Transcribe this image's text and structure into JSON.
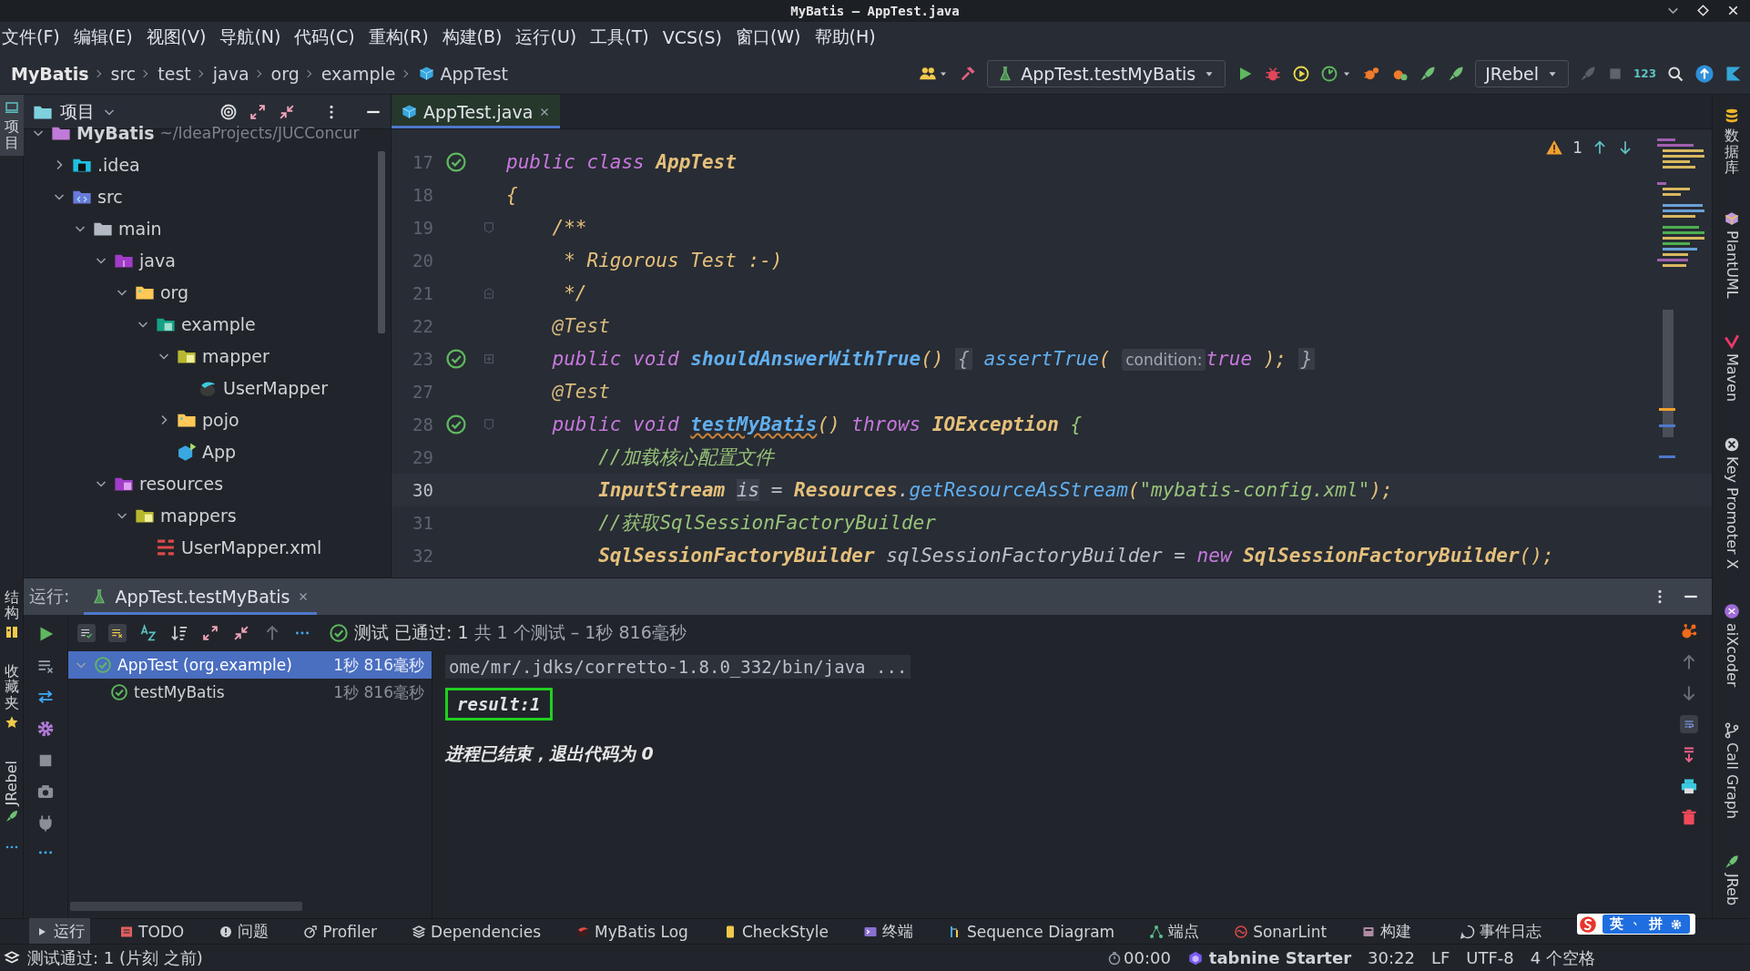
{
  "window": {
    "title": "MyBatis – AppTest.java"
  },
  "menu": [
    "文件(F)",
    "编辑(E)",
    "视图(V)",
    "导航(N)",
    "代码(C)",
    "重构(R)",
    "构建(B)",
    "运行(U)",
    "工具(T)",
    "VCS(S)",
    "窗口(W)",
    "帮助(H)"
  ],
  "breadcrumb": [
    {
      "label": "MyBatis",
      "kind": "project"
    },
    {
      "label": "src",
      "kind": "dir"
    },
    {
      "label": "test",
      "kind": "dir"
    },
    {
      "label": "java",
      "kind": "dir"
    },
    {
      "label": "org",
      "kind": "dir"
    },
    {
      "label": "example",
      "kind": "dir"
    },
    {
      "label": "AppTest",
      "kind": "class"
    }
  ],
  "toolbar": {
    "run_config": "AppTest.testMyBatis",
    "jrebel": "JRebel",
    "counter": "123"
  },
  "left_stripe": [
    {
      "label": "项目",
      "kind": "project",
      "selected": true
    },
    {
      "label": "结构",
      "kind": "structure",
      "selected": false
    },
    {
      "label": "收藏夹",
      "kind": "favorites",
      "selected": false
    },
    {
      "label": "JRebel",
      "kind": "jrebel",
      "selected": false
    }
  ],
  "project": {
    "title": "项目",
    "tree": [
      {
        "label": "MyBatis",
        "path": "~/IdeaProjects/JUCConcur",
        "kind": "module",
        "expanded": true,
        "children": [
          {
            "label": ".idea",
            "kind": "idea",
            "expanded": false
          },
          {
            "label": "src",
            "kind": "source",
            "expanded": true,
            "children": [
              {
                "label": "main",
                "kind": "folder",
                "expanded": true,
                "children": [
                  {
                    "label": "java",
                    "kind": "java-root",
                    "expanded": true,
                    "children": [
                      {
                        "label": "org",
                        "kind": "package",
                        "expanded": true,
                        "children": [
                          {
                            "label": "example",
                            "kind": "test-package",
                            "expanded": true,
                            "children": [
                              {
                                "label": "mapper",
                                "kind": "mapper-package",
                                "expanded": true,
                                "children": [
                                  {
                                    "label": "UserMapper",
                                    "kind": "mapper"
                                  }
                                ]
                              },
                              {
                                "label": "pojo",
                                "kind": "package",
                                "expanded": false
                              },
                              {
                                "label": "App",
                                "kind": "class"
                              }
                            ]
                          }
                        ]
                      }
                    ]
                  },
                  {
                    "label": "resources",
                    "kind": "resources",
                    "expanded": true,
                    "children": [
                      {
                        "label": "mappers",
                        "kind": "mapper-package",
                        "expanded": true,
                        "children": [
                          {
                            "label": "UserMapper.xml",
                            "kind": "xml"
                          }
                        ]
                      }
                    ]
                  }
                ]
              }
            ]
          }
        ]
      }
    ]
  },
  "editor": {
    "tabs": [
      {
        "label": "AppTest.java",
        "selected": true
      }
    ],
    "warnings": "1",
    "lines": [
      {
        "number": "17",
        "marker": {
          "kind": "passed"
        },
        "current": false,
        "tokens": [
          {
            "text": "public class ",
            "kind": "kw"
          },
          {
            "text": "AppTest",
            "kind": "cls"
          }
        ]
      },
      {
        "number": "18",
        "current": false,
        "tokens": [
          {
            "text": "{",
            "kind": "paren"
          }
        ]
      },
      {
        "number": "19",
        "fold": {
          "kind": "start"
        },
        "current": false,
        "tokens": [
          {
            "text": "    /**",
            "kind": "doc"
          }
        ]
      },
      {
        "number": "20",
        "current": false,
        "tokens": [
          {
            "text": "     * Rigorous Test :-)",
            "kind": "doc"
          }
        ]
      },
      {
        "number": "21",
        "fold": {
          "kind": "end"
        },
        "current": false,
        "tokens": [
          {
            "text": "     */",
            "kind": "doc"
          }
        ]
      },
      {
        "number": "22",
        "current": false,
        "tokens": [
          {
            "text": "    @Test",
            "kind": "ann"
          }
        ]
      },
      {
        "number": "23",
        "marker": {
          "kind": "passed"
        },
        "fold": {
          "kind": "collapsed"
        },
        "current": false,
        "tokens": [
          {
            "text": "    public void ",
            "kind": "kw"
          },
          {
            "text": "shouldAnswerWithTrue",
            "kind": "method"
          },
          {
            "text": "() ",
            "kind": "paren"
          },
          {
            "text": "{",
            "kind": "folded"
          },
          {
            "text": " assertTrue",
            "kind": "call"
          },
          {
            "text": "( ",
            "kind": "paren"
          },
          {
            "text": "condition:",
            "kind": "hint"
          },
          {
            "text": "true",
            "kind": "kw"
          },
          {
            "text": " ); ",
            "kind": "paren"
          },
          {
            "text": "}",
            "kind": "folded"
          }
        ]
      },
      {
        "number": "27",
        "current": false,
        "tokens": [
          {
            "text": "    @Test",
            "kind": "ann"
          }
        ]
      },
      {
        "number": "28",
        "marker": {
          "kind": "passed"
        },
        "fold": {
          "kind": "start"
        },
        "current": false,
        "tokens": [
          {
            "text": "    public void ",
            "kind": "kw"
          },
          {
            "text": "testMyBatis",
            "kind": "method-warn"
          },
          {
            "text": "()",
            "kind": "paren"
          },
          {
            "text": " throws ",
            "kind": "kw"
          },
          {
            "text": "IOException ",
            "kind": "cls"
          },
          {
            "text": "{",
            "kind": "brace"
          }
        ]
      },
      {
        "number": "29",
        "current": false,
        "tokens": [
          {
            "text": "        //加载核心配置文件",
            "kind": "comment"
          }
        ]
      },
      {
        "number": "30",
        "current": true,
        "tokens": [
          {
            "text": "        InputStream ",
            "kind": "cls"
          },
          {
            "text": "is",
            "kind": "var"
          },
          {
            "text": " = ",
            "kind": "plain"
          },
          {
            "text": "Resources",
            "kind": "cls"
          },
          {
            "text": ".",
            "kind": "plain"
          },
          {
            "text": "getResourceAsStream",
            "kind": "call"
          },
          {
            "text": "(",
            "kind": "paren"
          },
          {
            "text": "\"mybatis-config.xml\"",
            "kind": "string"
          },
          {
            "text": ");",
            "kind": "paren"
          }
        ]
      },
      {
        "number": "31",
        "current": false,
        "tokens": [
          {
            "text": "        //获取SqlSessionFactoryBuilder",
            "kind": "comment"
          }
        ]
      },
      {
        "number": "32",
        "current": false,
        "tokens": [
          {
            "text": "        SqlSessionFactoryBuilder",
            "kind": "cls"
          },
          {
            "text": " sqlSessionFactoryBuilder = ",
            "kind": "plain"
          },
          {
            "text": "new ",
            "kind": "kw"
          },
          {
            "text": "SqlSessionFactoryBuilder",
            "kind": "cls"
          },
          {
            "text": "();",
            "kind": "paren"
          }
        ]
      }
    ]
  },
  "right_stripe": [
    {
      "label": "数据库",
      "kind": "database"
    },
    {
      "label": "PlantUML",
      "kind": "plantuml"
    },
    {
      "label": "Maven",
      "kind": "maven"
    },
    {
      "label": "Key Promoter X",
      "kind": "keypromoter"
    },
    {
      "label": "aiXcoder",
      "kind": "aixcoder"
    },
    {
      "label": "Call Graph",
      "kind": "callgraph"
    },
    {
      "label": "JReb",
      "kind": "jrebel"
    }
  ],
  "run_panel": {
    "label": "运行:",
    "tabs": [
      {
        "label": "AppTest.testMyBatis",
        "selected": true
      }
    ],
    "summary": {
      "status": "测试 已通过: 1",
      "detail": "共 1 个测试 – 1秒 816毫秒"
    },
    "tests": [
      {
        "label": "AppTest (org.example)",
        "time": "1秒 816毫秒",
        "passed": true,
        "selected": true,
        "expanded": true,
        "children": [
          {
            "label": "testMyBatis",
            "time": "1秒 816毫秒",
            "passed": true,
            "selected": false
          }
        ]
      }
    ],
    "console": [
      {
        "text": "ome/mr/.jdks/corretto-1.8.0_332/bin/java ...",
        "kind": "command",
        "highlighted": false
      },
      {
        "text": "result:1",
        "kind": "output",
        "highlighted": true
      },
      {
        "text": "进程已结束，退出代码为 0",
        "kind": "exit",
        "highlighted": false
      }
    ]
  },
  "tool_tabs": [
    {
      "label": "运行",
      "kind": "run",
      "selected": true
    },
    {
      "label": "TODO",
      "kind": "todo",
      "selected": false
    },
    {
      "label": "问题",
      "kind": "problems",
      "selected": false
    },
    {
      "label": "Profiler",
      "kind": "profiler",
      "selected": false
    },
    {
      "label": "Dependencies",
      "kind": "dependencies",
      "selected": false
    },
    {
      "label": "MyBatis Log",
      "kind": "mybatis",
      "selected": false
    },
    {
      "label": "CheckStyle",
      "kind": "checkstyle",
      "selected": false
    },
    {
      "label": "终端",
      "kind": "terminal",
      "selected": false
    },
    {
      "label": "Sequence Diagram",
      "kind": "sequence",
      "selected": false
    },
    {
      "label": "端点",
      "kind": "endpoints",
      "selected": false
    },
    {
      "label": "SonarLint",
      "kind": "sonarlint",
      "selected": false
    },
    {
      "label": "构建",
      "kind": "build",
      "selected": false
    },
    {
      "label": "事件日志",
      "kind": "eventlog",
      "selected": false
    }
  ],
  "ime": {
    "mode": "英",
    "input": "拼"
  },
  "status_bar": {
    "message": "测试通过: 1 (片刻 之前)",
    "timer": "00:00",
    "tabnine": "tabnine Starter",
    "position": "30:22",
    "line_separator": "LF",
    "encoding": "UTF-8",
    "indent": "4 个空格"
  }
}
